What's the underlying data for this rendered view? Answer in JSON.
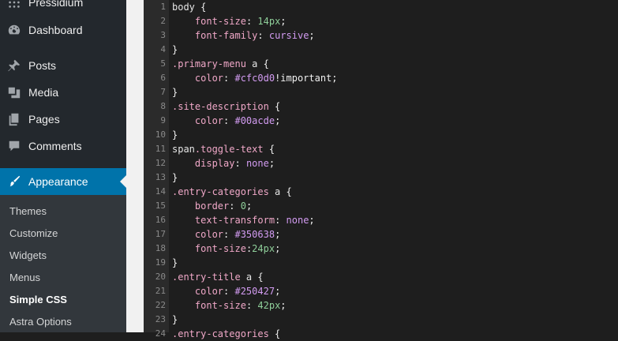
{
  "sidebar": {
    "site_name": "Pressidium",
    "items": [
      {
        "label": "Dashboard",
        "icon": "dashboard-icon"
      },
      {
        "label": "Posts",
        "icon": "pin-icon"
      },
      {
        "label": "Media",
        "icon": "media-icon"
      },
      {
        "label": "Pages",
        "icon": "pages-icon"
      },
      {
        "label": "Comments",
        "icon": "comments-icon"
      },
      {
        "label": "Appearance",
        "icon": "paintbrush-icon"
      }
    ],
    "submenu": [
      "Themes",
      "Customize",
      "Widgets",
      "Menus",
      "Simple CSS",
      "Astra Options"
    ],
    "current_submenu": "Simple CSS"
  },
  "editor": {
    "lines": [
      {
        "n": "1",
        "tokens": [
          [
            "sel",
            "body"
          ],
          [
            "punc",
            " {"
          ]
        ]
      },
      {
        "n": "2",
        "tokens": [
          [
            "punc",
            "    "
          ],
          [
            "prop",
            "font-size"
          ],
          [
            "punc",
            ": "
          ],
          [
            "num",
            "14px"
          ],
          [
            "punc",
            ";"
          ]
        ]
      },
      {
        "n": "3",
        "tokens": [
          [
            "punc",
            "    "
          ],
          [
            "prop",
            "font-family"
          ],
          [
            "punc",
            ": "
          ],
          [
            "val",
            "cursive"
          ],
          [
            "punc",
            ";"
          ]
        ]
      },
      {
        "n": "4",
        "tokens": [
          [
            "punc",
            "}"
          ]
        ]
      },
      {
        "n": "5",
        "tokens": [
          [
            "prop",
            ".primary-menu"
          ],
          [
            "sel",
            " a"
          ],
          [
            "punc",
            " {"
          ]
        ]
      },
      {
        "n": "6",
        "tokens": [
          [
            "punc",
            "    "
          ],
          [
            "prop",
            "color"
          ],
          [
            "punc",
            ": "
          ],
          [
            "val",
            "#cfc0d0"
          ],
          [
            "punc",
            "!important;"
          ]
        ]
      },
      {
        "n": "7",
        "tokens": [
          [
            "punc",
            "}"
          ]
        ]
      },
      {
        "n": "8",
        "tokens": [
          [
            "prop",
            ".site-description"
          ],
          [
            "punc",
            " {"
          ]
        ]
      },
      {
        "n": "9",
        "tokens": [
          [
            "punc",
            "    "
          ],
          [
            "prop",
            "color"
          ],
          [
            "punc",
            ": "
          ],
          [
            "val",
            "#00acde"
          ],
          [
            "punc",
            ";"
          ]
        ]
      },
      {
        "n": "10",
        "tokens": [
          [
            "punc",
            "}"
          ]
        ]
      },
      {
        "n": "11",
        "tokens": [
          [
            "sel",
            "span"
          ],
          [
            "prop",
            ".toggle-text"
          ],
          [
            "punc",
            " {"
          ]
        ]
      },
      {
        "n": "12",
        "tokens": [
          [
            "punc",
            "    "
          ],
          [
            "prop",
            "display"
          ],
          [
            "punc",
            ": "
          ],
          [
            "val",
            "none"
          ],
          [
            "punc",
            ";"
          ]
        ]
      },
      {
        "n": "13",
        "tokens": [
          [
            "punc",
            "}"
          ]
        ]
      },
      {
        "n": "14",
        "tokens": [
          [
            "prop",
            ".entry-categories"
          ],
          [
            "sel",
            " a"
          ],
          [
            "punc",
            " {"
          ]
        ]
      },
      {
        "n": "15",
        "tokens": [
          [
            "punc",
            "    "
          ],
          [
            "prop",
            "border"
          ],
          [
            "punc",
            ": "
          ],
          [
            "num",
            "0"
          ],
          [
            "punc",
            ";"
          ]
        ]
      },
      {
        "n": "16",
        "tokens": [
          [
            "punc",
            "    "
          ],
          [
            "prop",
            "text-transform"
          ],
          [
            "punc",
            ": "
          ],
          [
            "val",
            "none"
          ],
          [
            "punc",
            ";"
          ]
        ]
      },
      {
        "n": "17",
        "tokens": [
          [
            "punc",
            "    "
          ],
          [
            "prop",
            "color"
          ],
          [
            "punc",
            ": "
          ],
          [
            "val",
            "#350638"
          ],
          [
            "punc",
            ";"
          ]
        ]
      },
      {
        "n": "18",
        "tokens": [
          [
            "punc",
            "    "
          ],
          [
            "prop",
            "font-size"
          ],
          [
            "punc",
            ":"
          ],
          [
            "num",
            "24px"
          ],
          [
            "punc",
            ";"
          ]
        ]
      },
      {
        "n": "19",
        "tokens": [
          [
            "punc",
            "}"
          ]
        ]
      },
      {
        "n": "20",
        "tokens": [
          [
            "prop",
            ".entry-title"
          ],
          [
            "sel",
            " a"
          ],
          [
            "punc",
            " {"
          ]
        ]
      },
      {
        "n": "21",
        "tokens": [
          [
            "punc",
            "    "
          ],
          [
            "prop",
            "color"
          ],
          [
            "punc",
            ": "
          ],
          [
            "val",
            "#250427"
          ],
          [
            "punc",
            ";"
          ]
        ]
      },
      {
        "n": "22",
        "tokens": [
          [
            "punc",
            "    "
          ],
          [
            "prop",
            "font-size"
          ],
          [
            "punc",
            ": "
          ],
          [
            "num",
            "42px"
          ],
          [
            "punc",
            ";"
          ]
        ]
      },
      {
        "n": "23",
        "tokens": [
          [
            "punc",
            "}"
          ]
        ]
      },
      {
        "n": "24",
        "tokens": [
          [
            "prop",
            ".entry-categories"
          ],
          [
            "punc",
            " {"
          ]
        ]
      }
    ]
  },
  "colors": {
    "sidebar_bg": "#23282d",
    "submenu_bg": "#32373c",
    "active_bg": "#0073aa",
    "editor_bg": "#1e1e1e",
    "gutter_bg": "#2b2b2b"
  }
}
